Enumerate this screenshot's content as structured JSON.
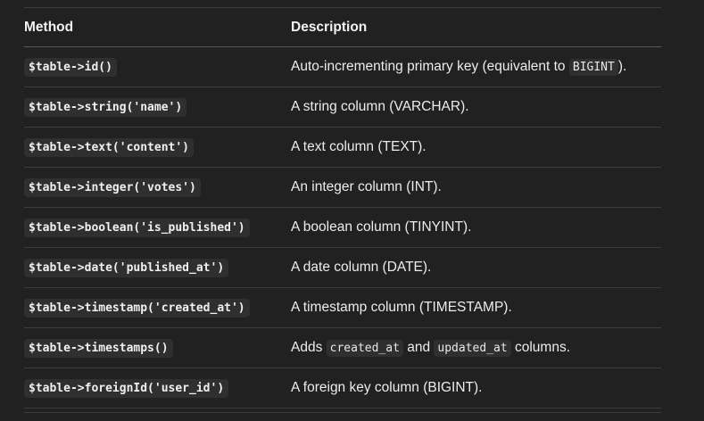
{
  "table": {
    "headers": {
      "method": "Method",
      "description": "Description"
    },
    "rows": [
      {
        "method": "$table->id()",
        "desc_parts": [
          "Auto-incrementing primary key (equivalent to ",
          "BIGINT",
          ")."
        ]
      },
      {
        "method": "$table->string('name')",
        "desc_parts": [
          "A string column (VARCHAR)."
        ]
      },
      {
        "method": "$table->text('content')",
        "desc_parts": [
          "A text column (TEXT)."
        ]
      },
      {
        "method": "$table->integer('votes')",
        "desc_parts": [
          "An integer column (INT)."
        ]
      },
      {
        "method": "$table->boolean('is_published')",
        "desc_parts": [
          "A boolean column (TINYINT)."
        ]
      },
      {
        "method": "$table->date('published_at')",
        "desc_parts": [
          "A date column (DATE)."
        ]
      },
      {
        "method": "$table->timestamp('created_at')",
        "desc_parts": [
          "A timestamp column (TIMESTAMP)."
        ]
      },
      {
        "method": "$table->timestamps()",
        "desc_parts": [
          "Adds ",
          "created_at",
          " and ",
          "updated_at",
          " columns."
        ]
      },
      {
        "method": "$table->foreignId('user_id')",
        "desc_parts": [
          "A foreign key column (BIGINT)."
        ]
      }
    ]
  },
  "colors": {
    "background": "#212121",
    "code_background": "#2f2f2f",
    "rule": "#3d3d3d",
    "text": "#ececec"
  }
}
